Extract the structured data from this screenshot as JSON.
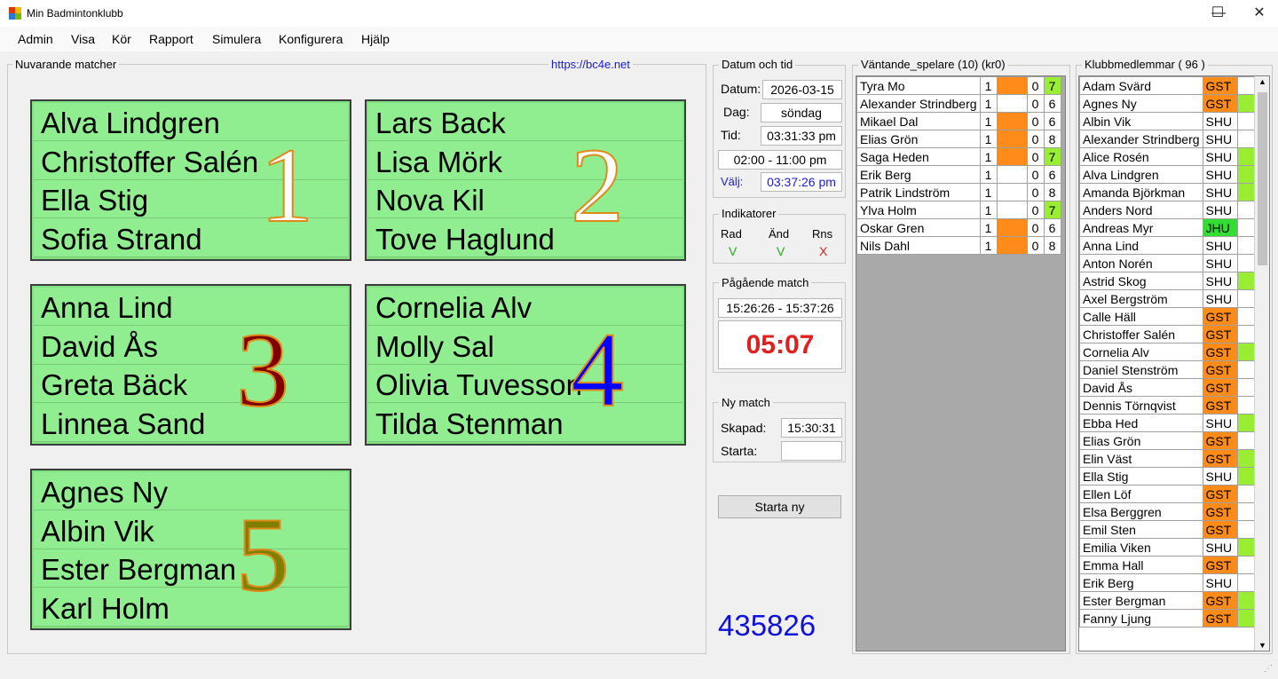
{
  "window": {
    "title": "Min Badmintonklubb",
    "minimize": "—",
    "maximize": "☐",
    "close": "✕"
  },
  "menu": [
    "Admin",
    "Visa",
    "Kör",
    "Rapport",
    "Simulera",
    "Konfigurera",
    "Hjälp"
  ],
  "current_matches": {
    "label": "Nuvarande matcher",
    "link": "https://bc4e.net",
    "courts": [
      {
        "number": "1",
        "players": [
          "Alva Lindgren",
          "Christoffer Salén",
          "Ella Stig",
          "Sofia Strand"
        ],
        "number_color": "#ffffff"
      },
      {
        "number": "2",
        "players": [
          "Lars Back",
          "Lisa Mörk",
          "Nova Kil",
          "Tove Haglund"
        ],
        "number_color": "#ffffff"
      },
      {
        "number": "3",
        "players": [
          "Anna Lind",
          "David Ås",
          "Greta Bäck",
          "Linnea Sand"
        ],
        "number_color": "#800000"
      },
      {
        "number": "4",
        "players": [
          "Cornelia Alv",
          "Molly Sal",
          "Olivia Tuvesson",
          "Tilda Stenman"
        ],
        "number_color": "#0000ff"
      },
      {
        "number": "5",
        "players": [
          "Agnes Ny",
          "Albin Vik",
          "Ester Bergman",
          "Karl Holm"
        ],
        "number_color": "#808000"
      }
    ]
  },
  "datetime": {
    "label": "Datum och tid",
    "date_label": "Datum:",
    "date": "2026-03-15",
    "day_label": "Dag:",
    "day": "söndag",
    "time_label": "Tid:",
    "time": "03:31:33 pm",
    "range": "02:00 - 11:00 pm",
    "choose_label": "Välj:",
    "choose": "03:37:26 pm"
  },
  "indicators": {
    "label": "Indikatorer",
    "items": [
      {
        "name": "Rad",
        "mark": "V",
        "color": "#22aa22"
      },
      {
        "name": "Änd",
        "mark": "V",
        "color": "#22aa22"
      },
      {
        "name": "Rns",
        "mark": "X",
        "color": "#dd2222"
      }
    ]
  },
  "ongoing": {
    "label": "Pågående match",
    "range": "15:26:26 - 15:37:26",
    "timer": "05:07"
  },
  "new_match": {
    "label": "Ny match",
    "created_label": "Skapad:",
    "created": "15:30:31",
    "start_label": "Starta:",
    "start": "",
    "button": "Starta ny"
  },
  "counter": "435826",
  "waiting": {
    "label": "Väntande_spelare (10) (kr0)",
    "rows": [
      {
        "name": "Tyra Mo",
        "a": "1",
        "flag": "or",
        "b": "0",
        "c": "7",
        "cflag": "lg"
      },
      {
        "name": "Alexander Strindberg",
        "a": "1",
        "flag": "",
        "b": "0",
        "c": "6",
        "cflag": ""
      },
      {
        "name": "Mikael Dal",
        "a": "1",
        "flag": "or",
        "b": "0",
        "c": "6",
        "cflag": ""
      },
      {
        "name": "Elias Grön",
        "a": "1",
        "flag": "or",
        "b": "0",
        "c": "8",
        "cflag": ""
      },
      {
        "name": "Saga Heden",
        "a": "1",
        "flag": "or",
        "b": "0",
        "c": "7",
        "cflag": "lg"
      },
      {
        "name": "Erik Berg",
        "a": "1",
        "flag": "",
        "b": "0",
        "c": "6",
        "cflag": ""
      },
      {
        "name": "Patrik Lindström",
        "a": "1",
        "flag": "",
        "b": "0",
        "c": "8",
        "cflag": ""
      },
      {
        "name": "Ylva Holm",
        "a": "1",
        "flag": "",
        "b": "0",
        "c": "7",
        "cflag": "lg"
      },
      {
        "name": "Oskar Gren",
        "a": "1",
        "flag": "or",
        "b": "0",
        "c": "6",
        "cflag": ""
      },
      {
        "name": "Nils Dahl",
        "a": "1",
        "flag": "or",
        "b": "0",
        "c": "8",
        "cflag": ""
      }
    ]
  },
  "members": {
    "label": "Klubbmedlemmar ( 96 )",
    "rows": [
      {
        "name": "Adam Svärd",
        "type": "GST",
        "mark": ""
      },
      {
        "name": "Agnes Ny",
        "type": "GST",
        "mark": "lg"
      },
      {
        "name": "Albin Vik",
        "type": "SHU",
        "mark": ""
      },
      {
        "name": "Alexander Strindberg",
        "type": "SHU",
        "mark": ""
      },
      {
        "name": "Alice Rosén",
        "type": "SHU",
        "mark": "lg"
      },
      {
        "name": "Alva Lindgren",
        "type": "SHU",
        "mark": "lg"
      },
      {
        "name": "Amanda Björkman",
        "type": "SHU",
        "mark": "lg"
      },
      {
        "name": "Anders Nord",
        "type": "SHU",
        "mark": ""
      },
      {
        "name": "Andreas Myr",
        "type": "JHU",
        "mark": ""
      },
      {
        "name": "Anna Lind",
        "type": "SHU",
        "mark": ""
      },
      {
        "name": "Anton Norén",
        "type": "SHU",
        "mark": ""
      },
      {
        "name": "Astrid Skog",
        "type": "SHU",
        "mark": "lg"
      },
      {
        "name": "Axel Bergström",
        "type": "SHU",
        "mark": ""
      },
      {
        "name": "Calle Häll",
        "type": "GST",
        "mark": ""
      },
      {
        "name": "Christoffer Salén",
        "type": "GST",
        "mark": ""
      },
      {
        "name": "Cornelia Alv",
        "type": "GST",
        "mark": "lg"
      },
      {
        "name": "Daniel Stenström",
        "type": "GST",
        "mark": ""
      },
      {
        "name": "David Ås",
        "type": "GST",
        "mark": ""
      },
      {
        "name": "Dennis Törnqvist",
        "type": "GST",
        "mark": ""
      },
      {
        "name": "Ebba Hed",
        "type": "SHU",
        "mark": "lg"
      },
      {
        "name": "Elias Grön",
        "type": "GST",
        "mark": ""
      },
      {
        "name": "Elin Väst",
        "type": "GST",
        "mark": "lg"
      },
      {
        "name": "Ella Stig",
        "type": "SHU",
        "mark": "lg"
      },
      {
        "name": "Ellen Löf",
        "type": "GST",
        "mark": ""
      },
      {
        "name": "Elsa Berggren",
        "type": "GST",
        "mark": ""
      },
      {
        "name": "Emil Sten",
        "type": "GST",
        "mark": ""
      },
      {
        "name": "Emilia Viken",
        "type": "SHU",
        "mark": "lg"
      },
      {
        "name": "Emma Hall",
        "type": "GST",
        "mark": ""
      },
      {
        "name": "Erik Berg",
        "type": "SHU",
        "mark": ""
      },
      {
        "name": "Ester Bergman",
        "type": "GST",
        "mark": "lg"
      },
      {
        "name": "Fanny Ljung",
        "type": "GST",
        "mark": "lg"
      }
    ]
  }
}
